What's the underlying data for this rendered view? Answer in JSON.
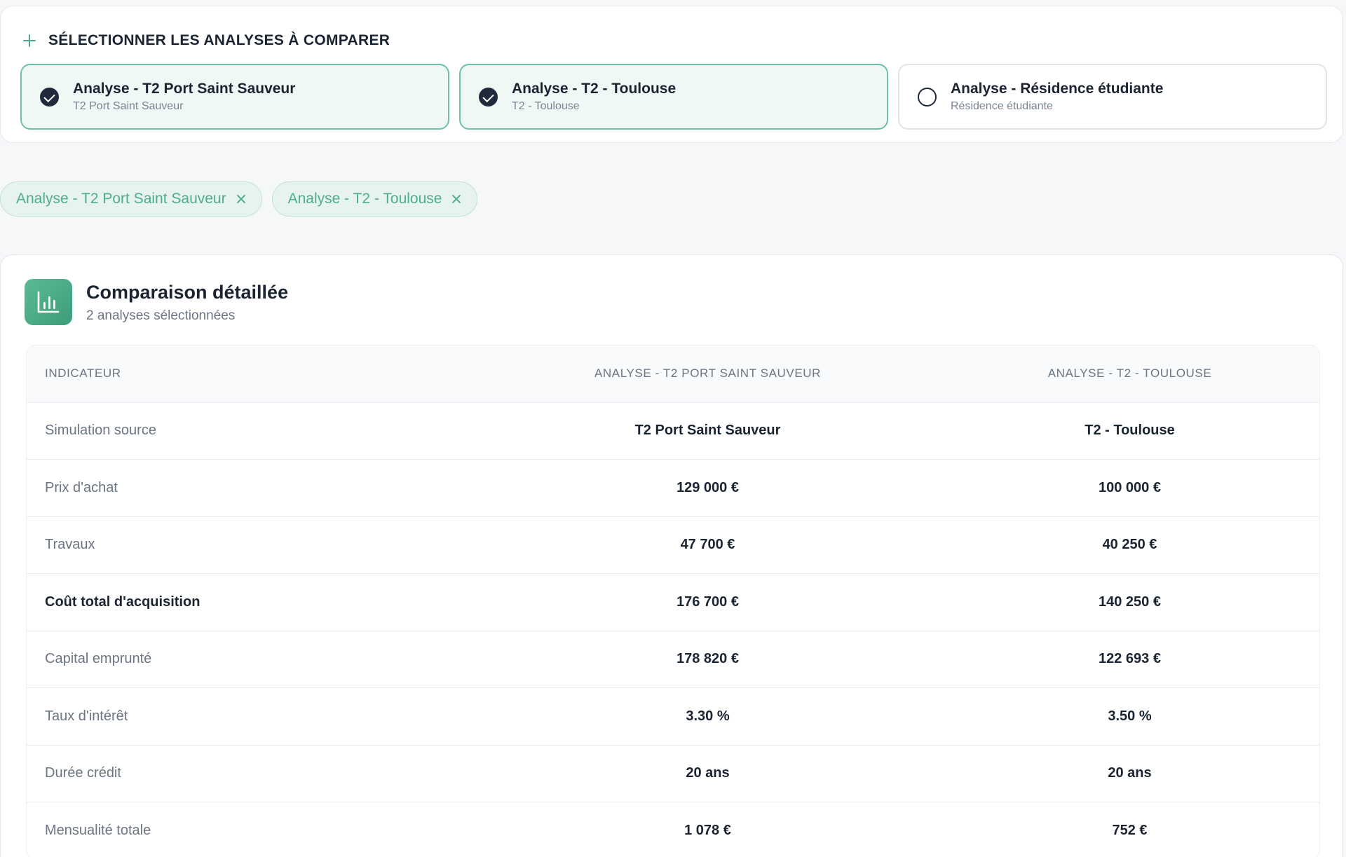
{
  "selection": {
    "title": "SÉLECTIONNER LES ANALYSES À COMPARER",
    "cards": [
      {
        "title": "Analyse - T2 Port Saint Sauveur",
        "subtitle": "T2 Port Saint Sauveur",
        "selected": true
      },
      {
        "title": "Analyse - T2 - Toulouse",
        "subtitle": "T2 - Toulouse",
        "selected": true
      },
      {
        "title": "Analyse - Résidence étudiante",
        "subtitle": "Résidence étudiante",
        "selected": false
      }
    ]
  },
  "chips": [
    {
      "label": "Analyse - T2 Port Saint Sauveur"
    },
    {
      "label": "Analyse - T2 - Toulouse"
    }
  ],
  "comparison": {
    "title": "Comparaison détaillée",
    "subtitle": "2 analyses sélectionnées",
    "headers": [
      "INDICATEUR",
      "ANALYSE - T2 PORT SAINT SAUVEUR",
      "ANALYSE - T2 - TOULOUSE"
    ],
    "rows": [
      {
        "label": "Simulation source",
        "a": "T2 Port Saint Sauveur",
        "b": "T2 - Toulouse"
      },
      {
        "label": "Prix d'achat",
        "a": "129 000 €",
        "b": "100 000 €"
      },
      {
        "label": "Travaux",
        "a": "47 700 €",
        "b": "40 250 €"
      },
      {
        "label": "Coût total d'acquisition",
        "a": "176 700 €",
        "b": "140 250 €"
      },
      {
        "label": "Capital emprunté",
        "a": "178 820 €",
        "b": "122 693 €"
      },
      {
        "label": "Taux d'intérêt",
        "a": "3.30 %",
        "b": "3.50 %"
      },
      {
        "label": "Durée crédit",
        "a": "20 ans",
        "b": "20 ans"
      },
      {
        "label": "Mensualité totale",
        "a": "1 078 €",
        "b": "752 €"
      }
    ]
  },
  "colors": {
    "accent": "#4fad89",
    "selected_border": "#6fc2a1",
    "selected_bg": "#eff8f5",
    "text": "#1a2433",
    "muted": "#6b7583"
  },
  "icons": {
    "header": "plus-icon",
    "badge": "bar-chart-icon",
    "chip_remove": "close-icon",
    "card_check": "check-circle-icon"
  }
}
